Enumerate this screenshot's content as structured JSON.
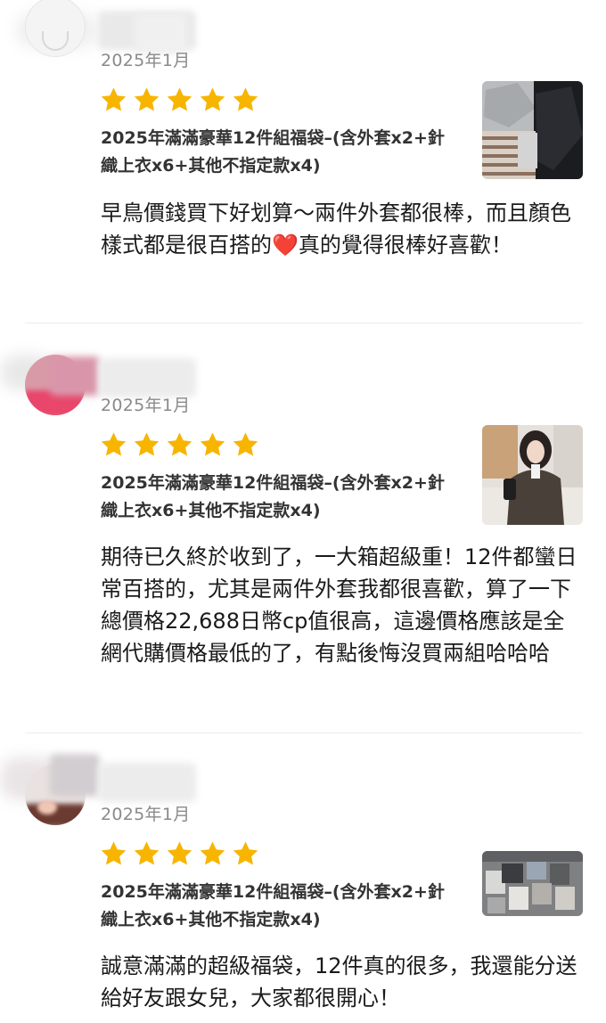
{
  "reviews": [
    {
      "date": "2025年1月",
      "rating": 5,
      "product": "2025年滿滿豪華12件組福袋–(含外套x2+針織上衣x6+其他不指定款x4)",
      "comment_before_heart": "早鳥價錢買下好划算～兩件外套都很棒，而且顏色樣式都是很百搭的",
      "heart": "❤️",
      "comment_after_heart": "真的覺得很棒好喜歡！"
    },
    {
      "date": "2025年1月",
      "rating": 5,
      "product": "2025年滿滿豪華12件組福袋–(含外套x2+針織上衣x6+其他不指定款x4)",
      "comment": "期待已久終於收到了，一大箱超級重！12件都蠻日常百搭的，尤其是兩件外套我都很喜歡，算了一下總價格22,688日幣cp值很高，這邊價格應該是全網代購價格最低的了，有點後悔沒買兩組哈哈哈"
    },
    {
      "date": "2025年1月",
      "rating": 5,
      "product": "2025年滿滿豪華12件組福袋–(含外套x2+針織上衣x6+其他不指定款x4)",
      "comment": "誠意滿滿的超級福袋，12件真的很多，我還能分送給好友跟女兒，大家都很開心！"
    }
  ],
  "colors": {
    "star": "#f7b500",
    "date": "#8a8a8a",
    "heart": "#e0262b"
  }
}
